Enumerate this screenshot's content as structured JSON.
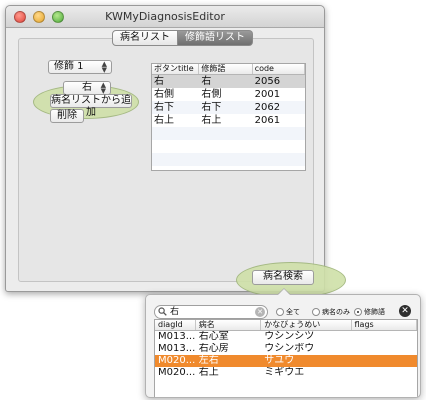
{
  "window": {
    "title": "KWMyDiagnosisEditor",
    "tabs": [
      {
        "label": "病名リスト",
        "active": false
      },
      {
        "label": "修飾語リスト",
        "active": true
      }
    ]
  },
  "controls": {
    "modifier_select": {
      "value": "修飾 1"
    },
    "position_select": {
      "value": "右"
    },
    "add_button_label": "病名リストから追加",
    "delete_button_label": "削除",
    "search_button_label": "病名検索"
  },
  "modifier_table": {
    "columns": [
      "ボタンtitle",
      "修飾語",
      "code"
    ],
    "rows": [
      {
        "title": "右",
        "modifier": "右",
        "code": "2056",
        "selected": true
      },
      {
        "title": "右側",
        "modifier": "右側",
        "code": "2001",
        "selected": false
      },
      {
        "title": "右下",
        "modifier": "右下",
        "code": "2062",
        "selected": false
      },
      {
        "title": "右上",
        "modifier": "右上",
        "code": "2061",
        "selected": false
      }
    ]
  },
  "popover": {
    "search_value": "右",
    "radio_options": [
      {
        "label": "全て",
        "checked": false
      },
      {
        "label": "病名のみ",
        "checked": false
      },
      {
        "label": "修飾語",
        "checked": true
      }
    ],
    "columns": [
      "diagId",
      "病名",
      "かなびょうめい",
      "flags"
    ],
    "rows": [
      {
        "id": "M013...",
        "name": "右心室",
        "kana": "ウシンシツ",
        "flags": "",
        "selected": false
      },
      {
        "id": "M013...",
        "name": "右心房",
        "kana": "ウシンボウ",
        "flags": "",
        "selected": false
      },
      {
        "id": "M020...",
        "name": "左右",
        "kana": "サユウ",
        "flags": "",
        "selected": true
      },
      {
        "id": "M020...",
        "name": "右上",
        "kana": "ミギウエ",
        "flags": "",
        "selected": false
      }
    ]
  },
  "colors": {
    "selection_orange": "#f08a2d",
    "halo_green": "#cfe0a8",
    "tab_active": "#7f7f7f"
  },
  "icons": [
    "close-window-icon",
    "minimize-window-icon",
    "zoom-window-icon",
    "search-icon",
    "clear-search-icon",
    "close-popover-icon"
  ]
}
